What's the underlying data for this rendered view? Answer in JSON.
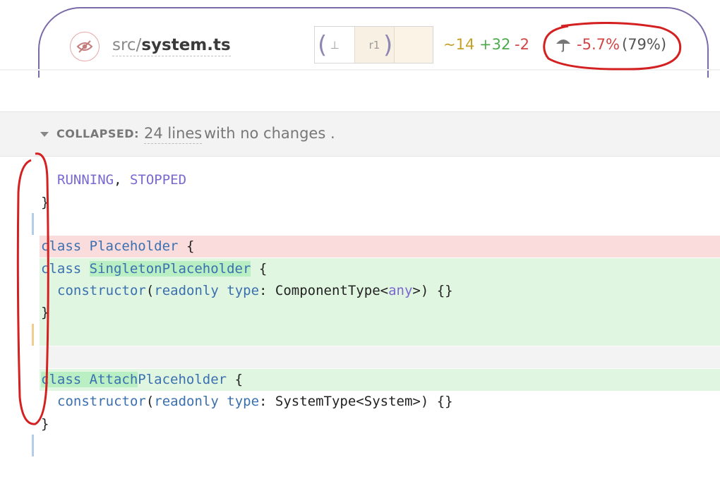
{
  "header": {
    "file_dir": "src/",
    "file_name": "system.ts",
    "revisions": {
      "base_symbol": "⊥",
      "r1": "r1"
    },
    "stats": {
      "modified": "~14",
      "added": "+32",
      "removed": "-2"
    },
    "coverage": {
      "delta": "-5.7%",
      "total": "(79%)"
    }
  },
  "collapsed": {
    "label": "COLLAPSED:",
    "count": "24 lines",
    "rest": "with no changes ."
  },
  "code": {
    "l1_a": "RUNNING",
    "l1_sep": ", ",
    "l1_b": "STOPPED",
    "l2": "}",
    "l4_kw": "class",
    "l4_name": "Placeholder",
    "l4_end": " {",
    "l5_kw": "class",
    "l5_name": "SingletonPlaceholder",
    "l5_end": " {",
    "l6_fn": "constructor",
    "l6_p1": "(",
    "l6_ro": "readonly",
    "l6_type": "type",
    "l6_colon": ": ",
    "l6_t": "ComponentType<",
    "l6_any": "any",
    "l6_tail": ">) {}",
    "l7": "}",
    "l10_kw": "class",
    "l10_name_hl": "Attach",
    "l10_name_rest": "Placeholder",
    "l10_end": " {",
    "l11_fn": "constructor",
    "l11_p1": "(",
    "l11_ro": "readonly",
    "l11_type": "type",
    "l11_colon": ": ",
    "l11_t": "SystemType<System>) {}",
    "l12": "}"
  },
  "colors": {
    "added_bg": "#e1f6e1",
    "removed_bg": "#fbdcdc",
    "annotation_red": "#d42020",
    "header_border": "#7b6aa8"
  }
}
